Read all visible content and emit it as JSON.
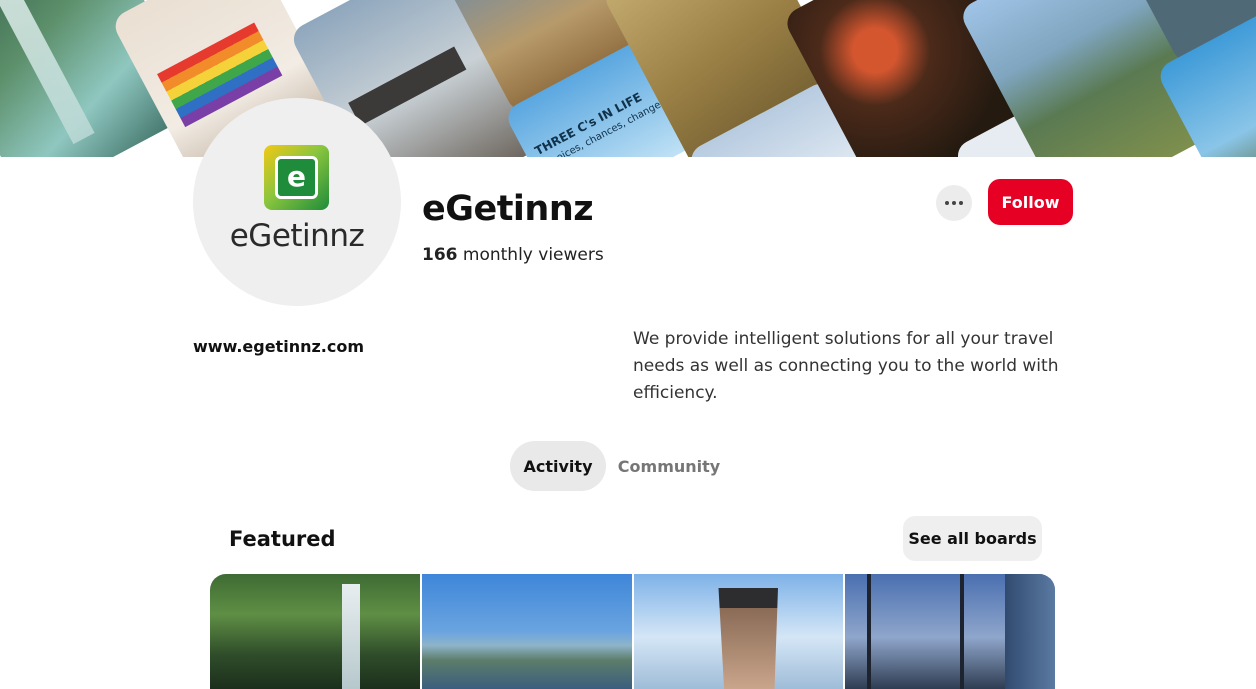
{
  "cover": {
    "sign_line1": "THREE C's IN LIFE",
    "sign_line2": "choices, chances, change"
  },
  "profile": {
    "avatar_logo_letter": "e",
    "avatar_name": "eGetinnz",
    "name": "eGetinnz",
    "viewer_count": "166",
    "viewer_label": "monthly viewers",
    "website": "www.egetinnz.com",
    "about": "We provide intelligent solutions for all your travel needs as well as connecting you to the world with efficiency."
  },
  "actions": {
    "more_icon": "more-horizontal-icon",
    "follow_label": "Follow"
  },
  "tabs": [
    {
      "label": "Activity",
      "selected": true
    },
    {
      "label": "Community",
      "selected": false
    }
  ],
  "featured": {
    "title": "Featured",
    "see_all_label": "See all boards"
  },
  "colors": {
    "follow_red": "#e60023",
    "tab_selected_bg": "#e9e9e9",
    "logo_green": "#1e8c3a",
    "logo_yellow": "#f2c814"
  }
}
